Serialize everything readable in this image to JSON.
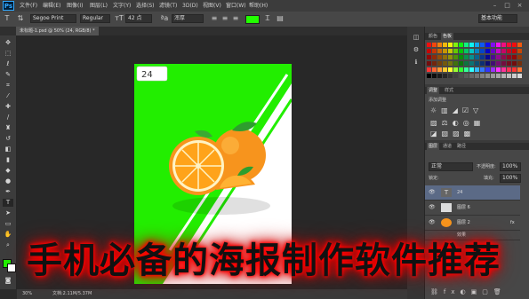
{
  "app": {
    "logo": "Ps"
  },
  "menu": [
    "文件(F)",
    "编辑(E)",
    "图像(I)",
    "图层(L)",
    "文字(Y)",
    "选择(S)",
    "滤镜(T)",
    "3D(D)",
    "视图(V)",
    "窗口(W)",
    "帮助(H)"
  ],
  "window_buttons": [
    "–",
    "□",
    "×"
  ],
  "options": {
    "font_family": "Segoe Print",
    "font_style": "Regular",
    "font_size": "42 点",
    "antialias": "浑厚",
    "color": "#22ff00",
    "workspace": "基本功能"
  },
  "document_tab": "未标题-1.psd @ 50% (24, RGB/8) *",
  "status": {
    "zoom": "30%",
    "doc_info": "文档:2.11M/5.37M"
  },
  "canvas": {
    "tag_text": "24",
    "accent": "#22ee00"
  },
  "panels": {
    "swatches_tabs": [
      "颜色",
      "色板"
    ],
    "adjust_tabs": [
      "调整",
      "样式"
    ],
    "adjust_title": "添加调整",
    "layers_tabs": [
      "图层",
      "通道",
      "路径"
    ],
    "blend_mode": "正常",
    "opacity_label": "不透明度:",
    "opacity_value": "100%",
    "fill_label": "填充:",
    "fill_value": "100%",
    "lock_label": "锁定:",
    "layers": [
      {
        "name": "24"
      },
      {
        "name": "图层 6"
      },
      {
        "name": "图层 2"
      },
      {
        "name": "效果"
      }
    ]
  },
  "caption": "手机必备的海报制作软件推荐"
}
